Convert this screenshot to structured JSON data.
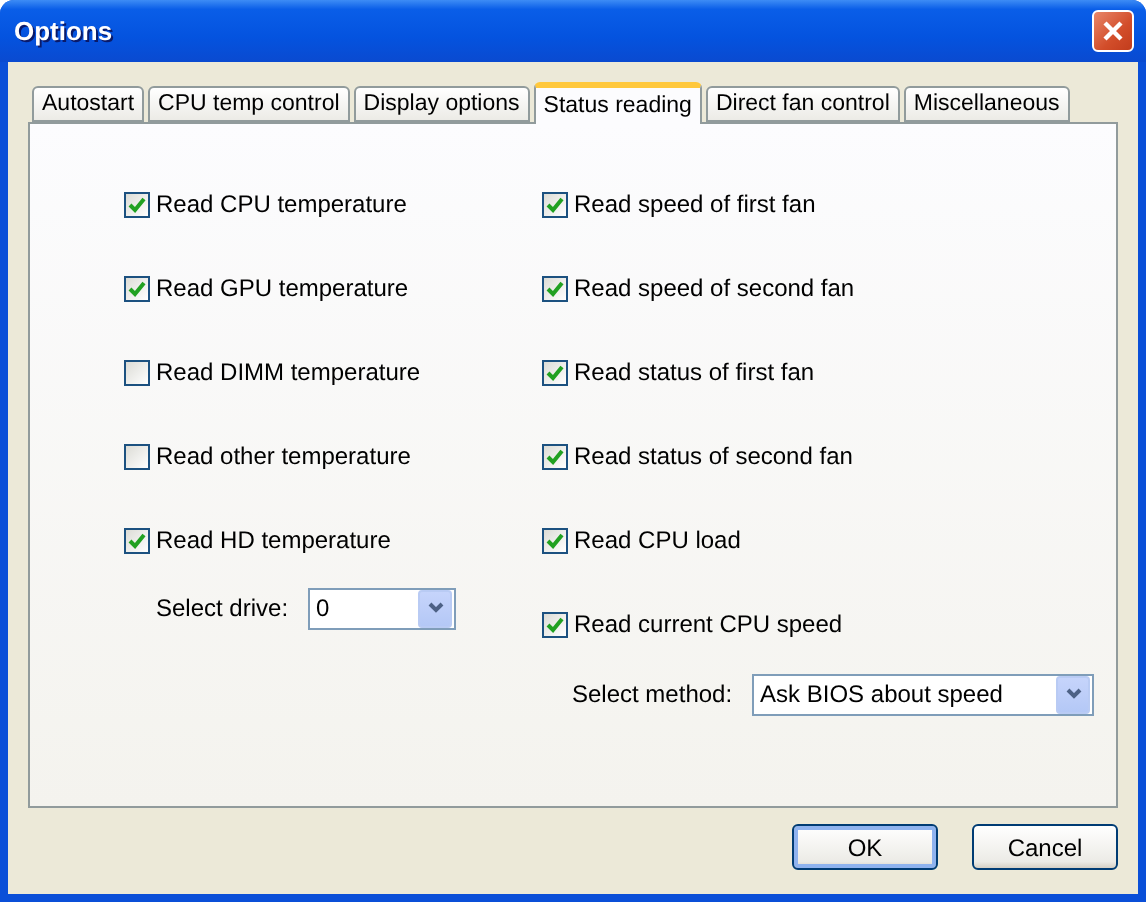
{
  "window": {
    "title": "Options"
  },
  "tabs": [
    {
      "label": "Autostart",
      "selected": false
    },
    {
      "label": "CPU temp control",
      "selected": false
    },
    {
      "label": "Display options",
      "selected": false
    },
    {
      "label": "Status reading",
      "selected": true
    },
    {
      "label": "Direct fan control",
      "selected": false
    },
    {
      "label": "Miscellaneous",
      "selected": false
    }
  ],
  "left_options": [
    {
      "label": "Read CPU temperature",
      "checked": true
    },
    {
      "label": "Read GPU temperature",
      "checked": true
    },
    {
      "label": "Read DIMM temperature",
      "checked": false
    },
    {
      "label": "Read other temperature",
      "checked": false
    },
    {
      "label": "Read HD temperature",
      "checked": true
    }
  ],
  "drive_select": {
    "label": "Select drive:",
    "value": "0"
  },
  "right_options": [
    {
      "label": "Read speed of first fan",
      "checked": true
    },
    {
      "label": "Read speed of second fan",
      "checked": true
    },
    {
      "label": "Read status of first fan",
      "checked": true
    },
    {
      "label": "Read status of second fan",
      "checked": true
    },
    {
      "label": "Read CPU load",
      "checked": true
    },
    {
      "label": "Read current CPU speed",
      "checked": true
    }
  ],
  "method_select": {
    "label": "Select method:",
    "value": "Ask BIOS about speed"
  },
  "buttons": [
    {
      "label": "OK",
      "default": true
    },
    {
      "label": "Cancel",
      "default": false
    }
  ]
}
